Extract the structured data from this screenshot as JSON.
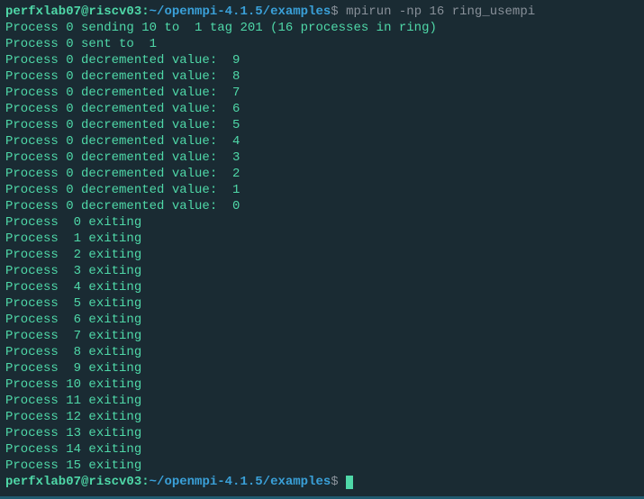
{
  "prompt1": {
    "user": "perfxlab07@riscv03",
    "colon": ":",
    "path": "~/openmpi-4.1.5/examples",
    "dollar": "$",
    "command": " mpirun -np 16 ring_usempi"
  },
  "output_lines": [
    "Process 0 sending 10 to  1 tag 201 (16 processes in ring)",
    "Process 0 sent to  1",
    "Process 0 decremented value:  9",
    "Process 0 decremented value:  8",
    "Process 0 decremented value:  7",
    "Process 0 decremented value:  6",
    "Process 0 decremented value:  5",
    "Process 0 decremented value:  4",
    "Process 0 decremented value:  3",
    "Process 0 decremented value:  2",
    "Process 0 decremented value:  1",
    "Process 0 decremented value:  0",
    "Process  0 exiting",
    "Process  1 exiting",
    "Process  2 exiting",
    "Process  3 exiting",
    "Process  4 exiting",
    "Process  5 exiting",
    "Process  6 exiting",
    "Process  7 exiting",
    "Process  8 exiting",
    "Process  9 exiting",
    "Process 10 exiting",
    "Process 11 exiting",
    "Process 12 exiting",
    "Process 13 exiting",
    "Process 14 exiting",
    "Process 15 exiting"
  ],
  "prompt2": {
    "user": "perfxlab07@riscv03",
    "colon": ":",
    "path": "~/openmpi-4.1.5/examples",
    "dollar": "$",
    "space": " "
  }
}
